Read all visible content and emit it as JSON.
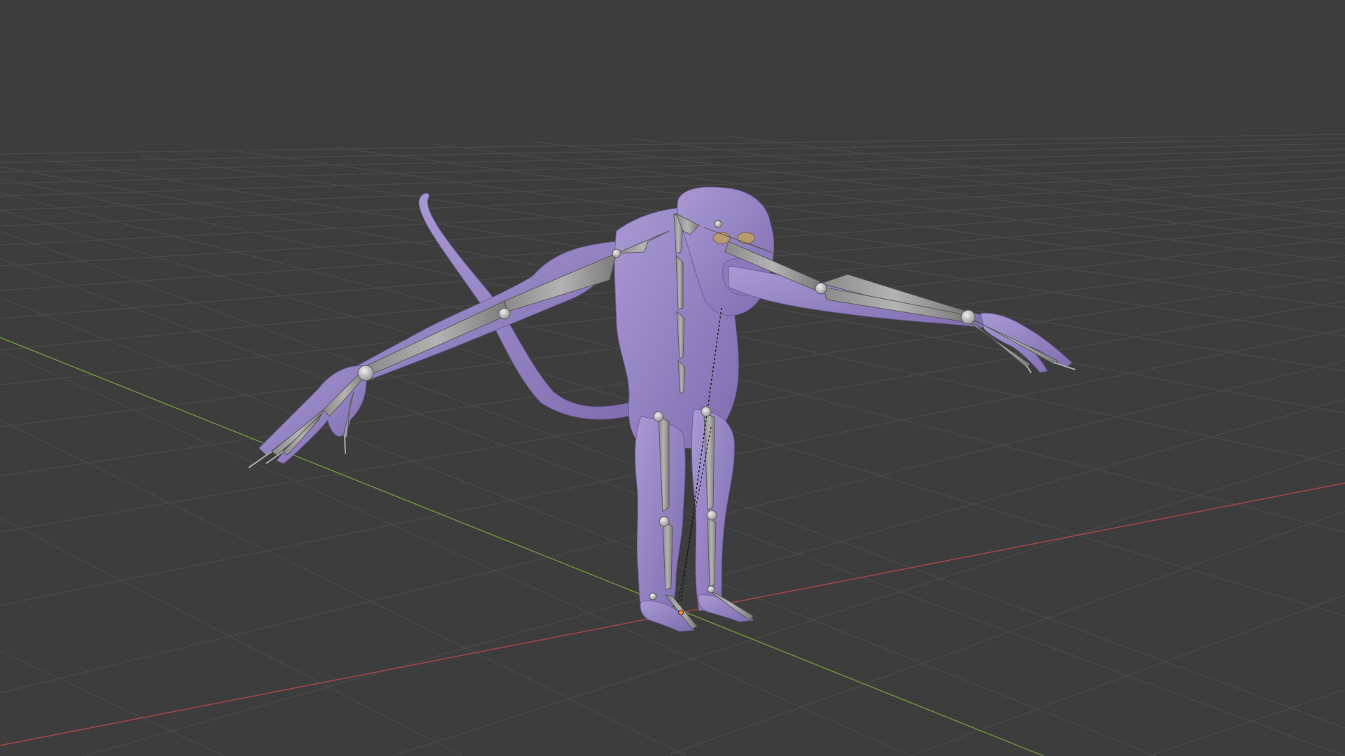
{
  "viewport": {
    "background_color": "#3d3d3d",
    "grid_color": "#4a4a4a",
    "x_axis_color": "#a34545",
    "y_axis_color": "#6b8f3a"
  },
  "scene": {
    "mesh_color": "#9a87c6",
    "bone_color": "#a2a2a2",
    "joint_color": "#c9c9c9",
    "origin_color": "#ff8a2a"
  }
}
